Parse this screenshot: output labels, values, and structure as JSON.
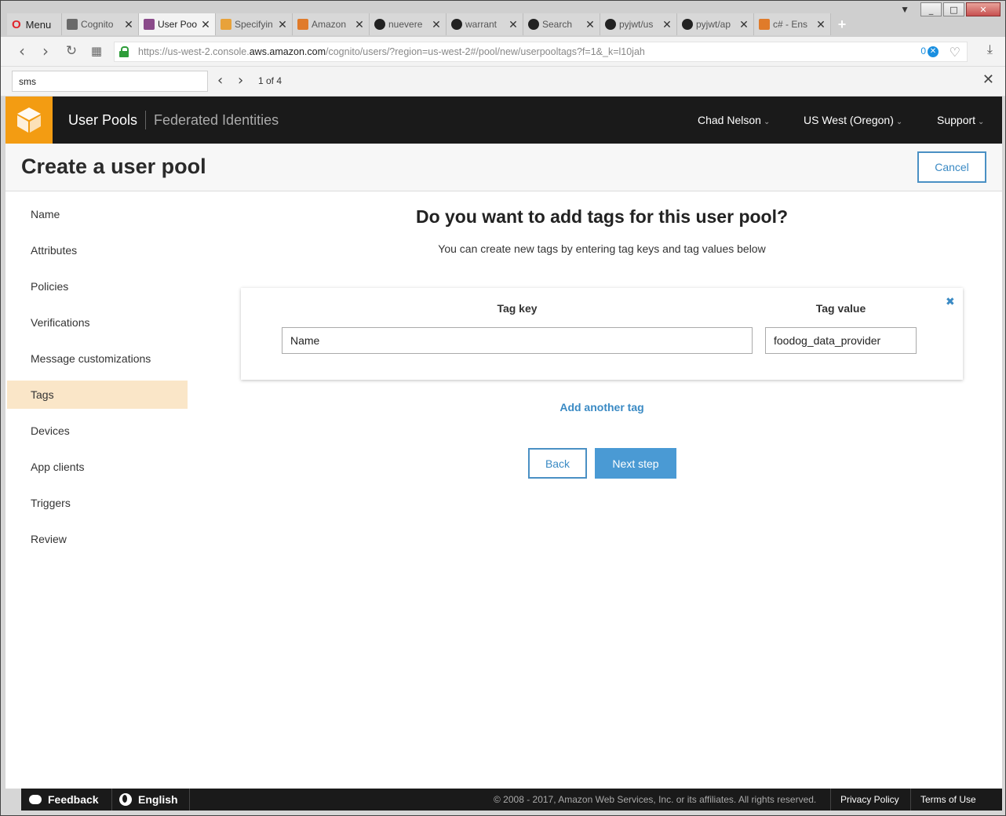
{
  "browser": {
    "menu_label": "Menu",
    "tabs": [
      {
        "title": "Cognito",
        "fav_color": "#6a6a6a"
      },
      {
        "title": "User Poo",
        "fav_color": "#8a4a8a"
      },
      {
        "title": "Specifyin",
        "fav_color": "#e8a23a"
      },
      {
        "title": "Amazon",
        "fav_color": "#e07b2a"
      },
      {
        "title": "nuevere",
        "fav_color": "#222222"
      },
      {
        "title": "warrant",
        "fav_color": "#222222"
      },
      {
        "title": "Search",
        "fav_color": "#222222"
      },
      {
        "title": "pyjwt/us",
        "fav_color": "#222222"
      },
      {
        "title": "pyjwt/ap",
        "fav_color": "#222222"
      },
      {
        "title": "c# - Ens",
        "fav_color": "#e07b2a"
      }
    ],
    "url_prefix": "https://us-west-2.console.",
    "url_host": "aws.amazon.com",
    "url_rest": "/cognito/users/?region=us-west-2#/pool/new/userpooltags?f=1&_k=l10jah",
    "badge_count": "0",
    "find": {
      "query": "sms",
      "count": "1 of 4"
    }
  },
  "aws_nav": {
    "user_pools": "User Pools",
    "federated": "Federated Identities",
    "user": "Chad Nelson",
    "region": "US West (Oregon)",
    "support": "Support",
    "accent": "#f39c12"
  },
  "page": {
    "title": "Create a user pool",
    "cancel_label": "Cancel"
  },
  "sidebar": {
    "items": [
      {
        "label": "Name"
      },
      {
        "label": "Attributes"
      },
      {
        "label": "Policies"
      },
      {
        "label": "Verifications"
      },
      {
        "label": "Message customizations"
      },
      {
        "label": "Tags"
      },
      {
        "label": "Devices"
      },
      {
        "label": "App clients"
      },
      {
        "label": "Triggers"
      },
      {
        "label": "Review"
      }
    ],
    "active_item": "Tags"
  },
  "main": {
    "heading": "Do you want to add tags for this user pool?",
    "subheading": "You can create new tags by entering tag keys and tag values below",
    "tag_key_label": "Tag key",
    "tag_value_label": "Tag value",
    "tags": [
      {
        "key": "Name",
        "value": "foodog_data_provider"
      }
    ],
    "add_tag_label": "Add another tag",
    "back_label": "Back",
    "next_label": "Next step"
  },
  "footer": {
    "feedback": "Feedback",
    "language": "English",
    "copyright": "© 2008 - 2017, Amazon Web Services, Inc. or its affiliates. All rights reserved.",
    "privacy": "Privacy Policy",
    "terms": "Terms of Use"
  }
}
